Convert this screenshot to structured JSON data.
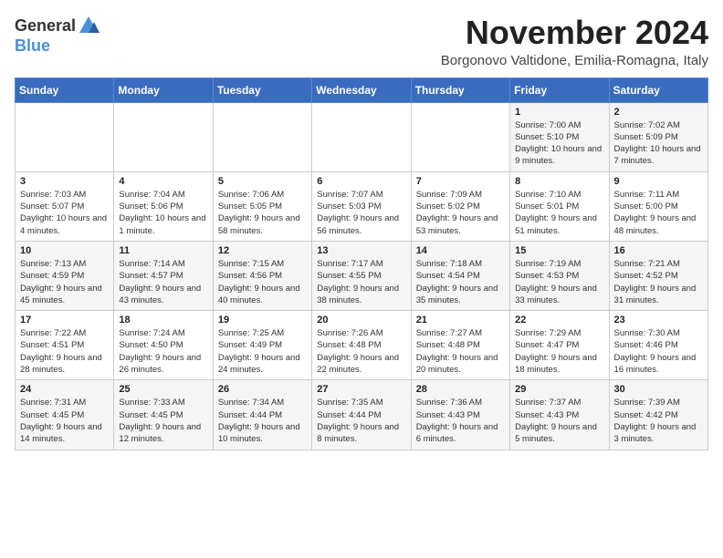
{
  "header": {
    "logo_general": "General",
    "logo_blue": "Blue",
    "month": "November 2024",
    "location": "Borgonovo Valtidone, Emilia-Romagna, Italy"
  },
  "weekdays": [
    "Sunday",
    "Monday",
    "Tuesday",
    "Wednesday",
    "Thursday",
    "Friday",
    "Saturday"
  ],
  "weeks": [
    [
      {
        "day": "",
        "info": ""
      },
      {
        "day": "",
        "info": ""
      },
      {
        "day": "",
        "info": ""
      },
      {
        "day": "",
        "info": ""
      },
      {
        "day": "",
        "info": ""
      },
      {
        "day": "1",
        "info": "Sunrise: 7:00 AM\nSunset: 5:10 PM\nDaylight: 10 hours and 9 minutes."
      },
      {
        "day": "2",
        "info": "Sunrise: 7:02 AM\nSunset: 5:09 PM\nDaylight: 10 hours and 7 minutes."
      }
    ],
    [
      {
        "day": "3",
        "info": "Sunrise: 7:03 AM\nSunset: 5:07 PM\nDaylight: 10 hours and 4 minutes."
      },
      {
        "day": "4",
        "info": "Sunrise: 7:04 AM\nSunset: 5:06 PM\nDaylight: 10 hours and 1 minute."
      },
      {
        "day": "5",
        "info": "Sunrise: 7:06 AM\nSunset: 5:05 PM\nDaylight: 9 hours and 58 minutes."
      },
      {
        "day": "6",
        "info": "Sunrise: 7:07 AM\nSunset: 5:03 PM\nDaylight: 9 hours and 56 minutes."
      },
      {
        "day": "7",
        "info": "Sunrise: 7:09 AM\nSunset: 5:02 PM\nDaylight: 9 hours and 53 minutes."
      },
      {
        "day": "8",
        "info": "Sunrise: 7:10 AM\nSunset: 5:01 PM\nDaylight: 9 hours and 51 minutes."
      },
      {
        "day": "9",
        "info": "Sunrise: 7:11 AM\nSunset: 5:00 PM\nDaylight: 9 hours and 48 minutes."
      }
    ],
    [
      {
        "day": "10",
        "info": "Sunrise: 7:13 AM\nSunset: 4:59 PM\nDaylight: 9 hours and 45 minutes."
      },
      {
        "day": "11",
        "info": "Sunrise: 7:14 AM\nSunset: 4:57 PM\nDaylight: 9 hours and 43 minutes."
      },
      {
        "day": "12",
        "info": "Sunrise: 7:15 AM\nSunset: 4:56 PM\nDaylight: 9 hours and 40 minutes."
      },
      {
        "day": "13",
        "info": "Sunrise: 7:17 AM\nSunset: 4:55 PM\nDaylight: 9 hours and 38 minutes."
      },
      {
        "day": "14",
        "info": "Sunrise: 7:18 AM\nSunset: 4:54 PM\nDaylight: 9 hours and 35 minutes."
      },
      {
        "day": "15",
        "info": "Sunrise: 7:19 AM\nSunset: 4:53 PM\nDaylight: 9 hours and 33 minutes."
      },
      {
        "day": "16",
        "info": "Sunrise: 7:21 AM\nSunset: 4:52 PM\nDaylight: 9 hours and 31 minutes."
      }
    ],
    [
      {
        "day": "17",
        "info": "Sunrise: 7:22 AM\nSunset: 4:51 PM\nDaylight: 9 hours and 28 minutes."
      },
      {
        "day": "18",
        "info": "Sunrise: 7:24 AM\nSunset: 4:50 PM\nDaylight: 9 hours and 26 minutes."
      },
      {
        "day": "19",
        "info": "Sunrise: 7:25 AM\nSunset: 4:49 PM\nDaylight: 9 hours and 24 minutes."
      },
      {
        "day": "20",
        "info": "Sunrise: 7:26 AM\nSunset: 4:48 PM\nDaylight: 9 hours and 22 minutes."
      },
      {
        "day": "21",
        "info": "Sunrise: 7:27 AM\nSunset: 4:48 PM\nDaylight: 9 hours and 20 minutes."
      },
      {
        "day": "22",
        "info": "Sunrise: 7:29 AM\nSunset: 4:47 PM\nDaylight: 9 hours and 18 minutes."
      },
      {
        "day": "23",
        "info": "Sunrise: 7:30 AM\nSunset: 4:46 PM\nDaylight: 9 hours and 16 minutes."
      }
    ],
    [
      {
        "day": "24",
        "info": "Sunrise: 7:31 AM\nSunset: 4:45 PM\nDaylight: 9 hours and 14 minutes."
      },
      {
        "day": "25",
        "info": "Sunrise: 7:33 AM\nSunset: 4:45 PM\nDaylight: 9 hours and 12 minutes."
      },
      {
        "day": "26",
        "info": "Sunrise: 7:34 AM\nSunset: 4:44 PM\nDaylight: 9 hours and 10 minutes."
      },
      {
        "day": "27",
        "info": "Sunrise: 7:35 AM\nSunset: 4:44 PM\nDaylight: 9 hours and 8 minutes."
      },
      {
        "day": "28",
        "info": "Sunrise: 7:36 AM\nSunset: 4:43 PM\nDaylight: 9 hours and 6 minutes."
      },
      {
        "day": "29",
        "info": "Sunrise: 7:37 AM\nSunset: 4:43 PM\nDaylight: 9 hours and 5 minutes."
      },
      {
        "day": "30",
        "info": "Sunrise: 7:39 AM\nSunset: 4:42 PM\nDaylight: 9 hours and 3 minutes."
      }
    ]
  ]
}
